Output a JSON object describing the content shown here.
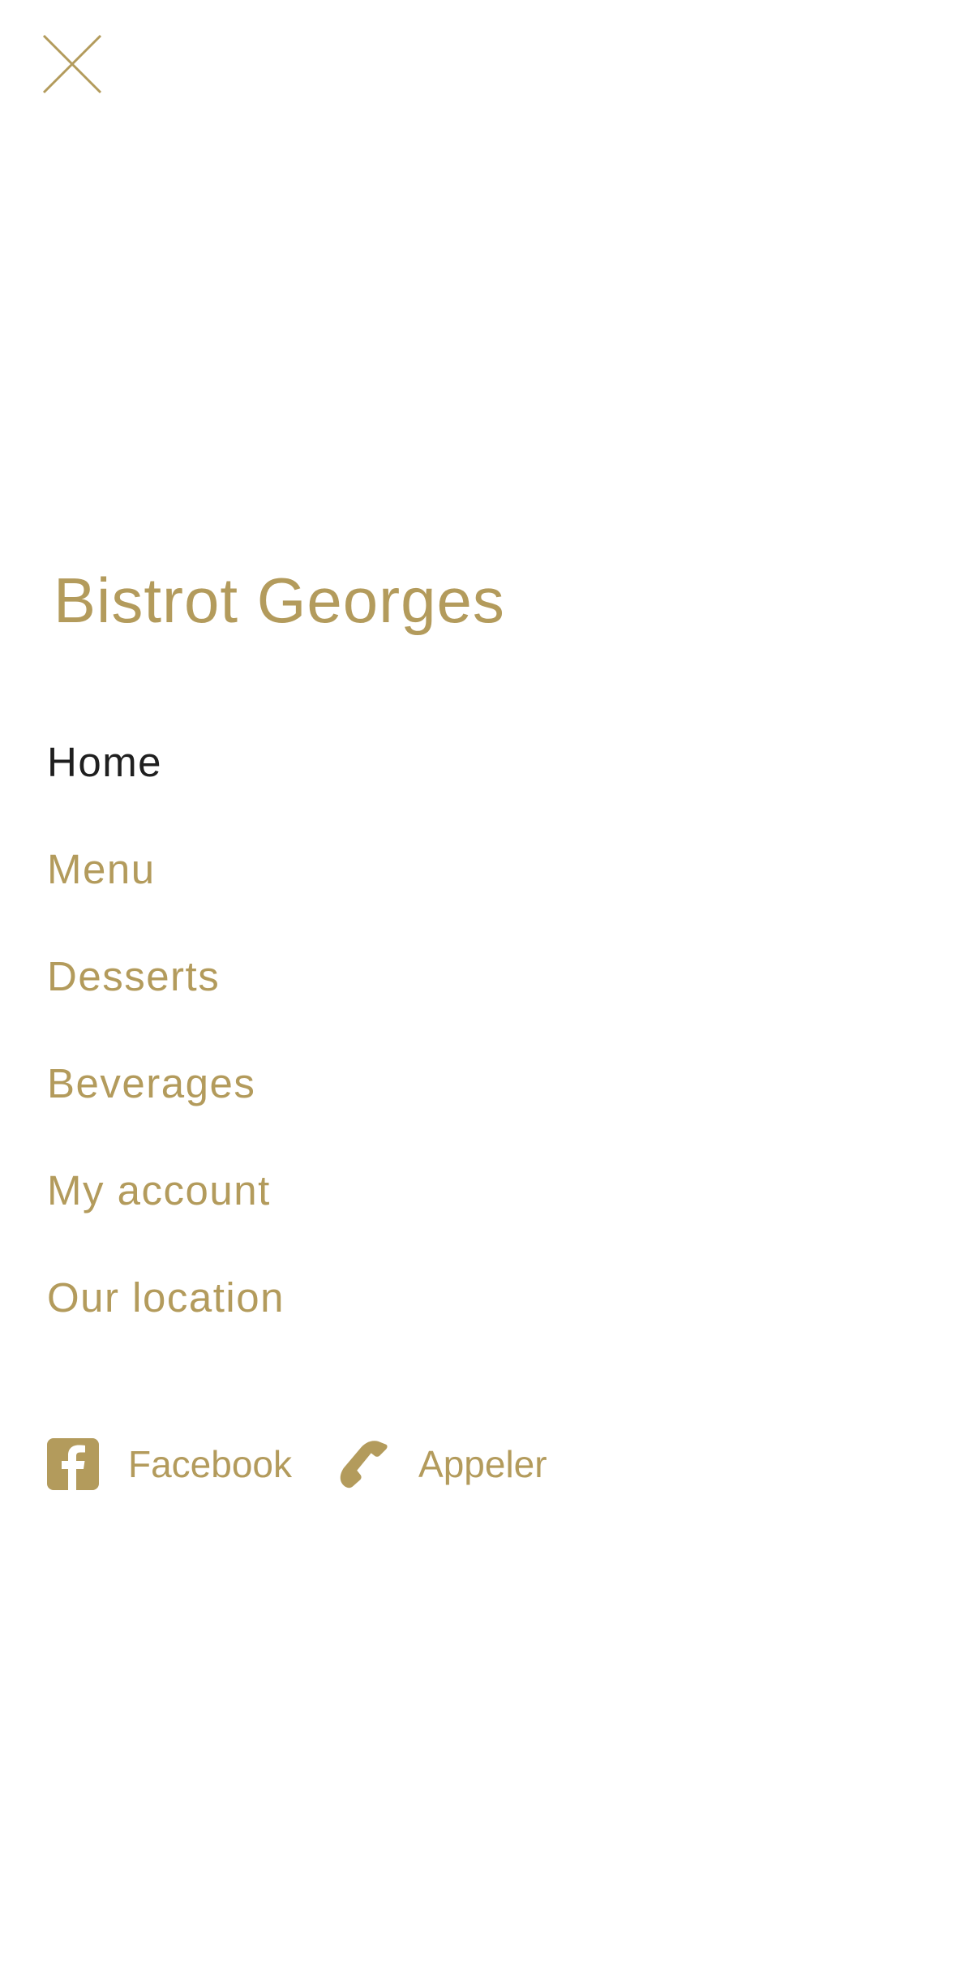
{
  "header": {
    "close_icon": "close-icon"
  },
  "brand": {
    "name": "Bistrot Georges",
    "color": "#b39b5c"
  },
  "nav": {
    "items": [
      {
        "label": "Home",
        "active": true
      },
      {
        "label": "Menu",
        "active": false
      },
      {
        "label": "Desserts",
        "active": false
      },
      {
        "label": "Beverages",
        "active": false
      },
      {
        "label": "My account",
        "active": false
      },
      {
        "label": "Our location",
        "active": false
      }
    ],
    "active_color": "#1f1f1f"
  },
  "social": {
    "facebook": {
      "label": "Facebook",
      "icon": "facebook-icon"
    },
    "call": {
      "label": "Appeler",
      "icon": "phone-icon"
    }
  }
}
